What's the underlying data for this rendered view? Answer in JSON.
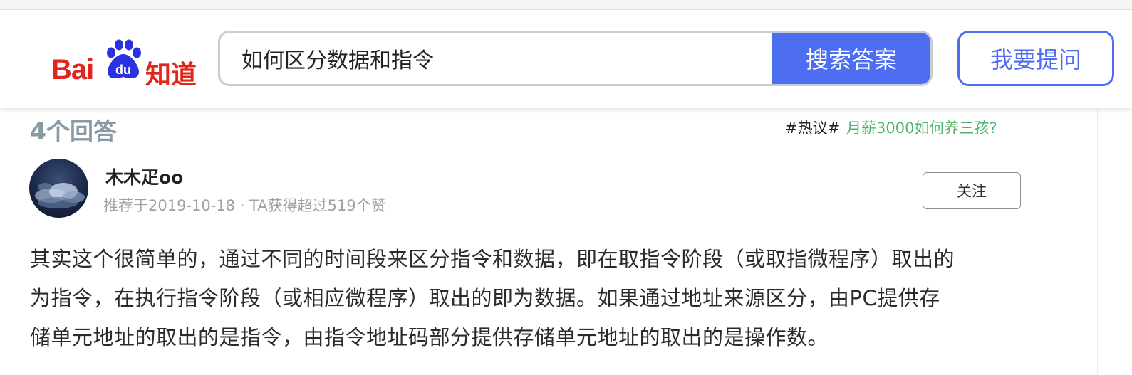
{
  "header": {
    "logo": {
      "bai_text": "Bai",
      "du_text": "du",
      "zhidao_text": "知道"
    },
    "search": {
      "value": "如何区分数据和指令",
      "button_label": "搜索答案"
    },
    "ask_button_label": "我要提问"
  },
  "answers": {
    "count_label": "4个回答",
    "hot_tag": "#热议#",
    "hot_link": "月薪3000如何养三孩?"
  },
  "answer": {
    "username": "木木疋oo",
    "meta": "推荐于2019-10-18 · TA获得超过519个赞",
    "follow_label": "关注",
    "lines": [
      "其实这个很简单的，通过不同的时间段来区分指令和数据，即在取指令阶段（或取指微程序）取出的",
      "为指令，在执行指令阶段（或相应微程序）取出的即为数据。如果通过地址来源区分，由PC提供存",
      "储单元地址的取出的是指令，由指令地址码部分提供存储单元地址的取出的是操作数。"
    ]
  },
  "colors": {
    "brand_red": "#e1251b",
    "brand_blue": "#4e6ef2",
    "paw_blue": "#2932e1",
    "hot_green": "#52b36b"
  }
}
